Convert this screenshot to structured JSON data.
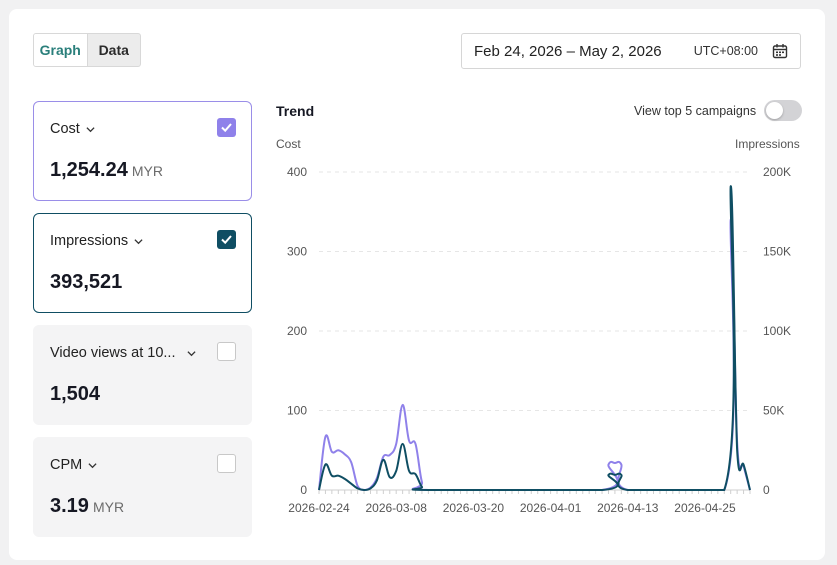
{
  "view_toggle": {
    "graph_label": "Graph",
    "data_label": "Data",
    "active": "Graph"
  },
  "date_picker": {
    "range": "Feb 24, 2026 – May 2, 2026",
    "timezone": "UTC+08:00",
    "icon": "calendar-icon"
  },
  "metrics": [
    {
      "name": "Cost",
      "value": "1,254.24",
      "unit": "MYR",
      "checked": true,
      "color": "#8f81ea"
    },
    {
      "name": "Impressions",
      "value": "393,521",
      "unit": "",
      "checked": true,
      "color": "#0f4e63"
    },
    {
      "name": "Video views at 10...",
      "value": "1,504",
      "unit": "",
      "checked": false
    },
    {
      "name": "CPM",
      "value": "3.19",
      "unit": "MYR",
      "checked": false
    }
  ],
  "trend": {
    "title": "Trend",
    "toggle_label": "View top 5 campaigns",
    "toggle_on": false
  },
  "chart_data": {
    "type": "line",
    "ylabel_left": "Cost",
    "ylabel_right": "Impressions",
    "ylim_left": [
      0,
      400
    ],
    "ylim_right": [
      0,
      200000
    ],
    "yticks_left": [
      "0",
      "100",
      "200",
      "300",
      "400"
    ],
    "yticks_right": [
      "0",
      "50K",
      "100K",
      "150K",
      "200K"
    ],
    "xtick_labels": [
      "2026-02-24",
      "2026-03-08",
      "2026-03-20",
      "2026-04-01",
      "2026-04-13",
      "2026-04-25"
    ],
    "xtick_days": [
      0,
      12,
      24,
      36,
      48,
      60
    ],
    "x_range_days": [
      0,
      67
    ],
    "grid": true,
    "series": [
      {
        "name": "Cost",
        "axis": "left",
        "color": "#8f81ea",
        "points": [
          [
            0,
            0
          ],
          [
            1,
            67
          ],
          [
            2,
            48
          ],
          [
            3,
            50
          ],
          [
            4,
            45
          ],
          [
            5,
            35
          ],
          [
            6,
            5
          ],
          [
            7,
            0
          ],
          [
            8,
            3
          ],
          [
            9,
            15
          ],
          [
            10,
            42
          ],
          [
            11,
            44
          ],
          [
            12,
            58
          ],
          [
            13,
            107
          ],
          [
            14,
            62
          ],
          [
            15,
            58
          ],
          [
            16,
            10
          ],
          [
            17,
            0
          ],
          [
            44,
            0
          ],
          [
            45,
            32
          ],
          [
            46,
            34
          ],
          [
            47,
            32
          ],
          [
            48,
            0
          ],
          [
            63,
            0
          ],
          [
            64,
            340
          ],
          [
            65,
            60
          ],
          [
            66,
            30
          ],
          [
            67,
            0
          ]
        ]
      },
      {
        "name": "Impressions",
        "axis": "right",
        "color": "#0f4e63",
        "points": [
          [
            0,
            0
          ],
          [
            1,
            16000
          ],
          [
            2,
            9000
          ],
          [
            3,
            9000
          ],
          [
            4,
            7000
          ],
          [
            5,
            4000
          ],
          [
            6,
            1000
          ],
          [
            7,
            0
          ],
          [
            8,
            1000
          ],
          [
            9,
            6000
          ],
          [
            10,
            19000
          ],
          [
            11,
            8000
          ],
          [
            12,
            12000
          ],
          [
            13,
            29000
          ],
          [
            14,
            12000
          ],
          [
            15,
            10000
          ],
          [
            16,
            2000
          ],
          [
            17,
            0
          ],
          [
            44,
            0
          ],
          [
            45,
            9500
          ],
          [
            46,
            9500
          ],
          [
            47,
            9500
          ],
          [
            48,
            0
          ],
          [
            63,
            0
          ],
          [
            64,
            191000
          ],
          [
            65,
            25000
          ],
          [
            66,
            16000
          ],
          [
            67,
            0
          ]
        ]
      }
    ]
  }
}
